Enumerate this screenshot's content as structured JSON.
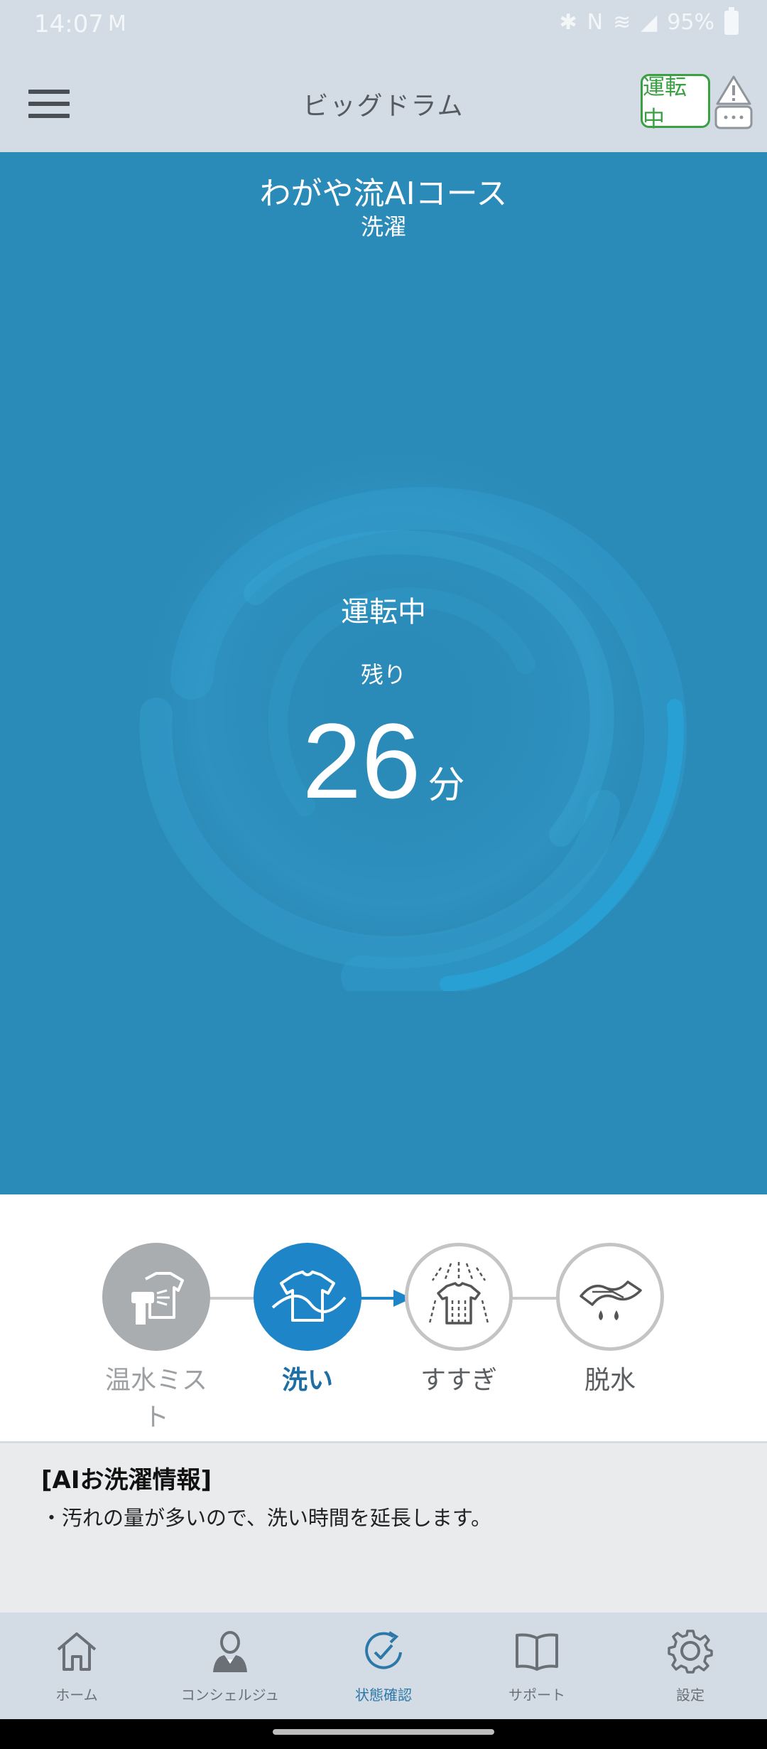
{
  "status_bar": {
    "time": "14:07",
    "battery": "95%"
  },
  "app_bar": {
    "title": "ビッグドラム",
    "run_badge": "運転中"
  },
  "hero": {
    "course_name": "わがや流AIコース",
    "mode": "洗濯",
    "state": "運転中",
    "remaining_label": "残り",
    "remaining_value": "26",
    "remaining_unit": "分"
  },
  "steps": [
    {
      "label": "温水ミスト",
      "status": "done"
    },
    {
      "label": "洗い",
      "status": "active"
    },
    {
      "label": "すすぎ",
      "status": "pending"
    },
    {
      "label": "脱水",
      "status": "pending"
    }
  ],
  "info": {
    "heading": "[AIお洗濯情報]",
    "body": "・汚れの量が多いので、洗い時間を延長します。"
  },
  "nav": [
    {
      "label": "ホーム",
      "icon": "home-icon"
    },
    {
      "label": "コンシェルジュ",
      "icon": "concierge-icon"
    },
    {
      "label": "状態確認",
      "icon": "status-check-icon",
      "active": true
    },
    {
      "label": "サポート",
      "icon": "book-icon"
    },
    {
      "label": "設定",
      "icon": "gear-icon"
    }
  ],
  "colors": {
    "hero_bg": "#2a8ab8",
    "accent": "#1e86c8",
    "run_green": "#3aa043",
    "nav_active": "#2c78a9"
  }
}
